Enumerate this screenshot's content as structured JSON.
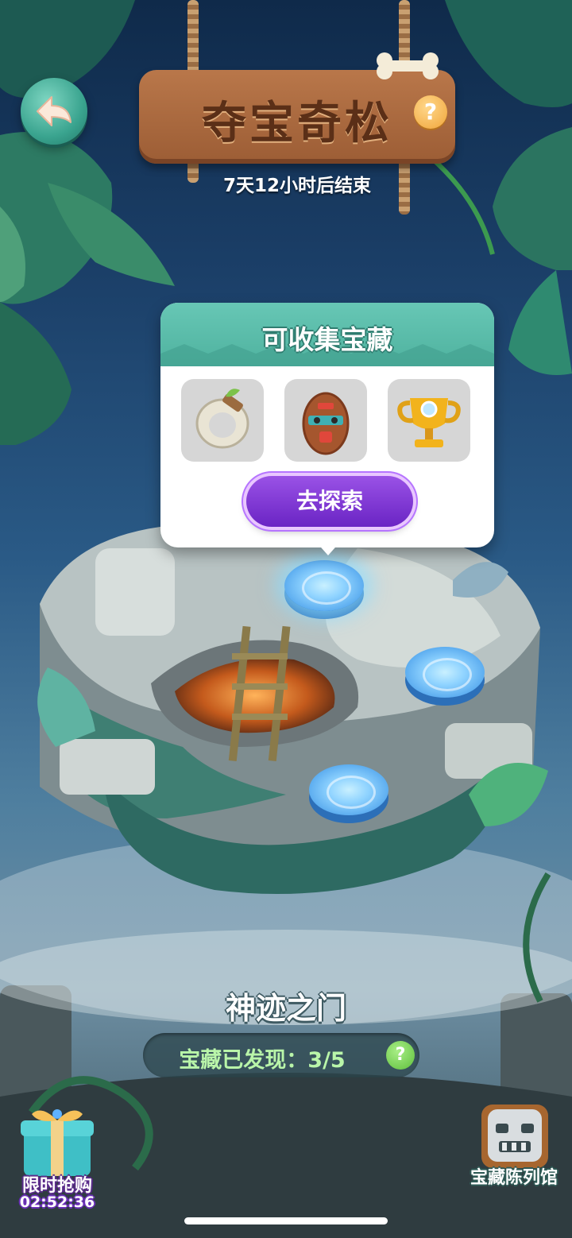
{
  "header": {
    "title": "夺宝奇松",
    "countdown": "7天12小时后结束"
  },
  "icons": {
    "back": "back-arrow-icon",
    "help": "question-mark-icon"
  },
  "popup": {
    "title": "可收集宝藏",
    "items": [
      {
        "name": "ring-icon"
      },
      {
        "name": "tribal-mask-icon"
      },
      {
        "name": "trophy-icon"
      }
    ],
    "button_label": "去探索"
  },
  "map": {
    "nodes": [
      {
        "name": "level-node-active",
        "active": true
      },
      {
        "name": "level-node",
        "active": false
      },
      {
        "name": "level-node",
        "active": false
      }
    ]
  },
  "area": {
    "name": "神迹之门",
    "progress_label": "宝藏已发现：3/5",
    "found": 3,
    "total": 5
  },
  "sale": {
    "label": "限时抢购",
    "timer": "02:52:36"
  },
  "museum": {
    "label": "宝藏陈列馆"
  },
  "colors": {
    "sky_top": "#0f2a4a",
    "teal_accent": "#4fb29f",
    "purple_button": "#7a33d6",
    "wood": "#a9663c"
  }
}
